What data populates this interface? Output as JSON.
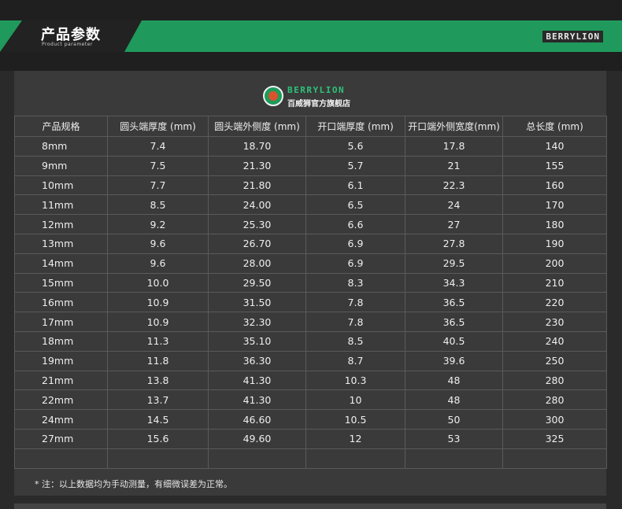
{
  "banner": {
    "title": "产品参数",
    "subtitle": "Product parameter",
    "brand": "BERRYLION"
  },
  "logo": {
    "brand": "BERRYLION",
    "shop": "百威狮官方旗舰店"
  },
  "colors": {
    "accent_green": "#1f9a5c",
    "panel": "#3a3a3a",
    "background": "#2a2a2a"
  },
  "table": {
    "headers": [
      "产品规格",
      "圆头端厚度 (mm)",
      "圆头端外侧度 (mm)",
      "开口端厚度 (mm)",
      "开口端外侧宽度(mm)",
      "总长度 (mm)"
    ],
    "rows": [
      [
        "8mm",
        "7.4",
        "18.70",
        "5.6",
        "17.8",
        "140"
      ],
      [
        "9mm",
        "7.5",
        "21.30",
        "5.7",
        "21",
        "155"
      ],
      [
        "10mm",
        "7.7",
        "21.80",
        "6.1",
        "22.3",
        "160"
      ],
      [
        "11mm",
        "8.5",
        "24.00",
        "6.5",
        "24",
        "170"
      ],
      [
        "12mm",
        "9.2",
        "25.30",
        "6.6",
        "27",
        "180"
      ],
      [
        "13mm",
        "9.6",
        "26.70",
        "6.9",
        "27.8",
        "190"
      ],
      [
        "14mm",
        "9.6",
        "28.00",
        "6.9",
        "29.5",
        "200"
      ],
      [
        "15mm",
        "10.0",
        "29.50",
        "8.3",
        "34.3",
        "210"
      ],
      [
        "16mm",
        "10.9",
        "31.50",
        "7.8",
        "36.5",
        "220"
      ],
      [
        "17mm",
        "10.9",
        "32.30",
        "7.8",
        "36.5",
        "230"
      ],
      [
        "18mm",
        "11.3",
        "35.10",
        "8.5",
        "40.5",
        "240"
      ],
      [
        "19mm",
        "11.8",
        "36.30",
        "8.7",
        "39.6",
        "250"
      ],
      [
        "21mm",
        "13.8",
        "41.30",
        "10.3",
        "48",
        "280"
      ],
      [
        "22mm",
        "13.7",
        "41.30",
        "10",
        "48",
        "280"
      ],
      [
        "24mm",
        "14.5",
        "46.60",
        "10.5",
        "50",
        "300"
      ],
      [
        "27mm",
        "15.6",
        "49.60",
        "12",
        "53",
        "325"
      ]
    ]
  },
  "note": "* 注：以上数据均为手动测量，有细微误差为正常。"
}
